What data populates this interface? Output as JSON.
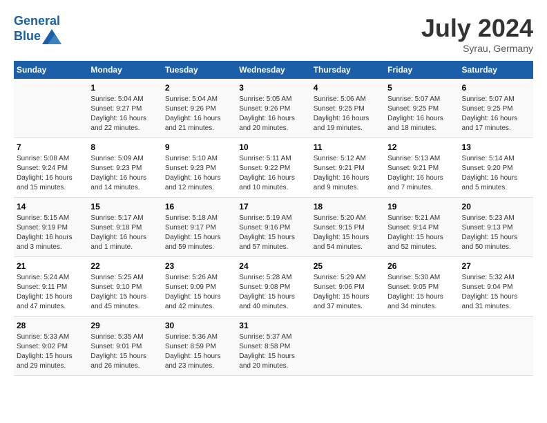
{
  "header": {
    "logo_line1": "General",
    "logo_line2": "Blue",
    "month": "July 2024",
    "location": "Syrau, Germany"
  },
  "columns": [
    "Sunday",
    "Monday",
    "Tuesday",
    "Wednesday",
    "Thursday",
    "Friday",
    "Saturday"
  ],
  "weeks": [
    [
      {
        "day": "",
        "sunrise": "",
        "sunset": "",
        "daylight": ""
      },
      {
        "day": "1",
        "sunrise": "Sunrise: 5:04 AM",
        "sunset": "Sunset: 9:27 PM",
        "daylight": "Daylight: 16 hours and 22 minutes."
      },
      {
        "day": "2",
        "sunrise": "Sunrise: 5:04 AM",
        "sunset": "Sunset: 9:26 PM",
        "daylight": "Daylight: 16 hours and 21 minutes."
      },
      {
        "day": "3",
        "sunrise": "Sunrise: 5:05 AM",
        "sunset": "Sunset: 9:26 PM",
        "daylight": "Daylight: 16 hours and 20 minutes."
      },
      {
        "day": "4",
        "sunrise": "Sunrise: 5:06 AM",
        "sunset": "Sunset: 9:25 PM",
        "daylight": "Daylight: 16 hours and 19 minutes."
      },
      {
        "day": "5",
        "sunrise": "Sunrise: 5:07 AM",
        "sunset": "Sunset: 9:25 PM",
        "daylight": "Daylight: 16 hours and 18 minutes."
      },
      {
        "day": "6",
        "sunrise": "Sunrise: 5:07 AM",
        "sunset": "Sunset: 9:25 PM",
        "daylight": "Daylight: 16 hours and 17 minutes."
      }
    ],
    [
      {
        "day": "7",
        "sunrise": "Sunrise: 5:08 AM",
        "sunset": "Sunset: 9:24 PM",
        "daylight": "Daylight: 16 hours and 15 minutes."
      },
      {
        "day": "8",
        "sunrise": "Sunrise: 5:09 AM",
        "sunset": "Sunset: 9:23 PM",
        "daylight": "Daylight: 16 hours and 14 minutes."
      },
      {
        "day": "9",
        "sunrise": "Sunrise: 5:10 AM",
        "sunset": "Sunset: 9:23 PM",
        "daylight": "Daylight: 16 hours and 12 minutes."
      },
      {
        "day": "10",
        "sunrise": "Sunrise: 5:11 AM",
        "sunset": "Sunset: 9:22 PM",
        "daylight": "Daylight: 16 hours and 10 minutes."
      },
      {
        "day": "11",
        "sunrise": "Sunrise: 5:12 AM",
        "sunset": "Sunset: 9:21 PM",
        "daylight": "Daylight: 16 hours and 9 minutes."
      },
      {
        "day": "12",
        "sunrise": "Sunrise: 5:13 AM",
        "sunset": "Sunset: 9:21 PM",
        "daylight": "Daylight: 16 hours and 7 minutes."
      },
      {
        "day": "13",
        "sunrise": "Sunrise: 5:14 AM",
        "sunset": "Sunset: 9:20 PM",
        "daylight": "Daylight: 16 hours and 5 minutes."
      }
    ],
    [
      {
        "day": "14",
        "sunrise": "Sunrise: 5:15 AM",
        "sunset": "Sunset: 9:19 PM",
        "daylight": "Daylight: 16 hours and 3 minutes."
      },
      {
        "day": "15",
        "sunrise": "Sunrise: 5:17 AM",
        "sunset": "Sunset: 9:18 PM",
        "daylight": "Daylight: 16 hours and 1 minute."
      },
      {
        "day": "16",
        "sunrise": "Sunrise: 5:18 AM",
        "sunset": "Sunset: 9:17 PM",
        "daylight": "Daylight: 15 hours and 59 minutes."
      },
      {
        "day": "17",
        "sunrise": "Sunrise: 5:19 AM",
        "sunset": "Sunset: 9:16 PM",
        "daylight": "Daylight: 15 hours and 57 minutes."
      },
      {
        "day": "18",
        "sunrise": "Sunrise: 5:20 AM",
        "sunset": "Sunset: 9:15 PM",
        "daylight": "Daylight: 15 hours and 54 minutes."
      },
      {
        "day": "19",
        "sunrise": "Sunrise: 5:21 AM",
        "sunset": "Sunset: 9:14 PM",
        "daylight": "Daylight: 15 hours and 52 minutes."
      },
      {
        "day": "20",
        "sunrise": "Sunrise: 5:23 AM",
        "sunset": "Sunset: 9:13 PM",
        "daylight": "Daylight: 15 hours and 50 minutes."
      }
    ],
    [
      {
        "day": "21",
        "sunrise": "Sunrise: 5:24 AM",
        "sunset": "Sunset: 9:11 PM",
        "daylight": "Daylight: 15 hours and 47 minutes."
      },
      {
        "day": "22",
        "sunrise": "Sunrise: 5:25 AM",
        "sunset": "Sunset: 9:10 PM",
        "daylight": "Daylight: 15 hours and 45 minutes."
      },
      {
        "day": "23",
        "sunrise": "Sunrise: 5:26 AM",
        "sunset": "Sunset: 9:09 PM",
        "daylight": "Daylight: 15 hours and 42 minutes."
      },
      {
        "day": "24",
        "sunrise": "Sunrise: 5:28 AM",
        "sunset": "Sunset: 9:08 PM",
        "daylight": "Daylight: 15 hours and 40 minutes."
      },
      {
        "day": "25",
        "sunrise": "Sunrise: 5:29 AM",
        "sunset": "Sunset: 9:06 PM",
        "daylight": "Daylight: 15 hours and 37 minutes."
      },
      {
        "day": "26",
        "sunrise": "Sunrise: 5:30 AM",
        "sunset": "Sunset: 9:05 PM",
        "daylight": "Daylight: 15 hours and 34 minutes."
      },
      {
        "day": "27",
        "sunrise": "Sunrise: 5:32 AM",
        "sunset": "Sunset: 9:04 PM",
        "daylight": "Daylight: 15 hours and 31 minutes."
      }
    ],
    [
      {
        "day": "28",
        "sunrise": "Sunrise: 5:33 AM",
        "sunset": "Sunset: 9:02 PM",
        "daylight": "Daylight: 15 hours and 29 minutes."
      },
      {
        "day": "29",
        "sunrise": "Sunrise: 5:35 AM",
        "sunset": "Sunset: 9:01 PM",
        "daylight": "Daylight: 15 hours and 26 minutes."
      },
      {
        "day": "30",
        "sunrise": "Sunrise: 5:36 AM",
        "sunset": "Sunset: 8:59 PM",
        "daylight": "Daylight: 15 hours and 23 minutes."
      },
      {
        "day": "31",
        "sunrise": "Sunrise: 5:37 AM",
        "sunset": "Sunset: 8:58 PM",
        "daylight": "Daylight: 15 hours and 20 minutes."
      },
      {
        "day": "",
        "sunrise": "",
        "sunset": "",
        "daylight": ""
      },
      {
        "day": "",
        "sunrise": "",
        "sunset": "",
        "daylight": ""
      },
      {
        "day": "",
        "sunrise": "",
        "sunset": "",
        "daylight": ""
      }
    ]
  ]
}
